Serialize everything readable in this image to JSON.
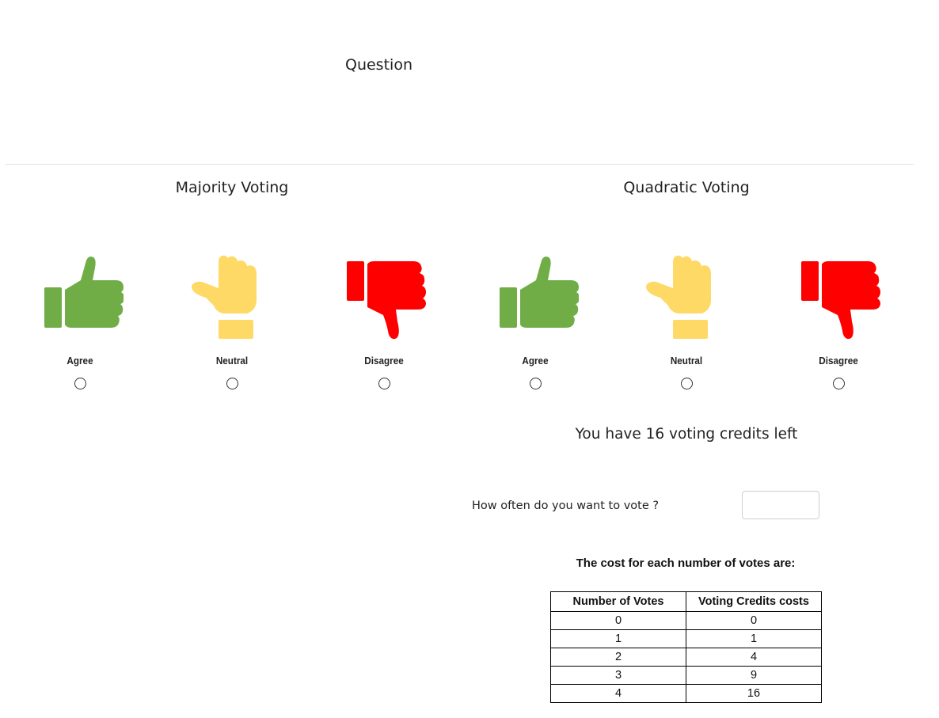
{
  "question": "Question",
  "sections": {
    "majority": {
      "title": "Majority Voting",
      "options": {
        "agree": "Agree",
        "neutral": "Neutral",
        "disagree": "Disagree"
      }
    },
    "quadratic": {
      "title": "Quadratic Voting",
      "options": {
        "agree": "Agree",
        "neutral": "Neutral",
        "disagree": "Disagree"
      }
    }
  },
  "icons": {
    "agree": {
      "name": "thumbs-up-icon",
      "color": "#70ad47"
    },
    "neutral": {
      "name": "thumb-sideways-icon",
      "color": "#ffd966"
    },
    "disagree": {
      "name": "thumbs-down-icon",
      "color": "#ff0000"
    }
  },
  "credits_text": "You have 16 voting credits left",
  "vote_prompt": "How often do you want to vote ?",
  "vote_input": {
    "value": "",
    "placeholder": ""
  },
  "cost_heading": "The cost for each number of votes are:",
  "cost_table": {
    "headers": [
      "Number of Votes",
      "Voting Credits costs"
    ],
    "rows": [
      [
        "0",
        "0"
      ],
      [
        "1",
        "1"
      ],
      [
        "2",
        "4"
      ],
      [
        "3",
        "9"
      ],
      [
        "4",
        "16"
      ]
    ]
  }
}
